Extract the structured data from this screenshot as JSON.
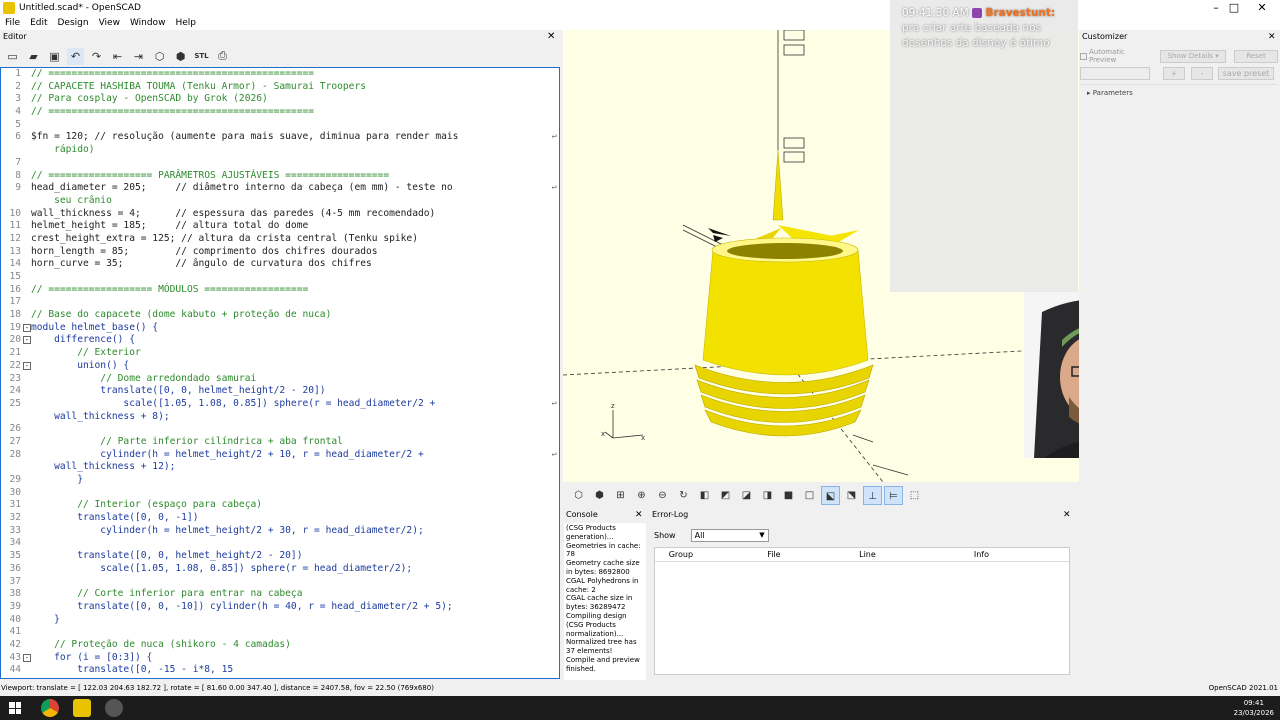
{
  "window": {
    "title": "Untitled.scad* - OpenSCAD",
    "controls": [
      "–",
      "□",
      "✕"
    ]
  },
  "menu": [
    "File",
    "Edit",
    "Design",
    "View",
    "Window",
    "Help"
  ],
  "editor": {
    "title": "Editor",
    "toolbar_icons": [
      "new-icon",
      "open-icon",
      "save-icon",
      "undo-icon",
      "redo-icon",
      "unindent-icon",
      "indent-icon",
      "preview-icon",
      "render-icon",
      "export-stl-icon",
      "send-to-print-icon"
    ],
    "stl_label": "STL",
    "lines": [
      {
        "n": "1",
        "t": "// ==============================================",
        "k": "comment",
        "f": ""
      },
      {
        "n": "2",
        "t": "// CAPACETE HASHIBA TOUMA (Tenku Armor) - Samurai Troopers",
        "k": "comment",
        "f": ""
      },
      {
        "n": "3",
        "t": "// Para cosplay - OpenSCAD by Grok (2026)",
        "k": "comment",
        "f": ""
      },
      {
        "n": "4",
        "t": "// ==============================================",
        "k": "comment",
        "f": ""
      },
      {
        "n": "5",
        "t": "",
        "k": "default",
        "f": ""
      },
      {
        "n": "6",
        "t": "$fn = 120; // resolução (aumente para mais suave, diminua para render mais",
        "k": "default",
        "f": "",
        "w": true
      },
      {
        "n": "",
        "t": "    rápido)",
        "k": "comment",
        "f": ""
      },
      {
        "n": "7",
        "t": "",
        "k": "default",
        "f": ""
      },
      {
        "n": "8",
        "t": "// ================== PARÂMETROS AJUSTÁVEIS ==================",
        "k": "comment",
        "f": ""
      },
      {
        "n": "9",
        "t": "head_diameter = 205;     // diâmetro interno da cabeça (em mm) - teste no",
        "k": "default",
        "f": "",
        "w": true
      },
      {
        "n": "",
        "t": "    seu crânio",
        "k": "comment",
        "f": ""
      },
      {
        "n": "10",
        "t": "wall_thickness = 4;      // espessura das paredes (4-5 mm recomendado)",
        "k": "default",
        "f": ""
      },
      {
        "n": "11",
        "t": "helmet_height = 185;     // altura total do dome",
        "k": "default",
        "f": ""
      },
      {
        "n": "12",
        "t": "crest_height_extra = 125; // altura da crista central (Tenku spike)",
        "k": "default",
        "f": ""
      },
      {
        "n": "13",
        "t": "horn_length = 85;        // comprimento dos chifres dourados",
        "k": "default",
        "f": ""
      },
      {
        "n": "14",
        "t": "horn_curve = 35;         // ângulo de curvatura dos chifres",
        "k": "default",
        "f": ""
      },
      {
        "n": "15",
        "t": "",
        "k": "default",
        "f": ""
      },
      {
        "n": "16",
        "t": "// ================== MÓDULOS ==================",
        "k": "comment",
        "f": ""
      },
      {
        "n": "17",
        "t": "",
        "k": "default",
        "f": ""
      },
      {
        "n": "18",
        "t": "// Base do capacete (dome kabuto + proteção de nuca)",
        "k": "comment",
        "f": ""
      },
      {
        "n": "19",
        "t": "module helmet_base() {",
        "k": "keyword",
        "f": "-"
      },
      {
        "n": "20",
        "t": "    difference() {",
        "k": "keyword",
        "f": "-"
      },
      {
        "n": "21",
        "t": "        // Exterior",
        "k": "comment",
        "f": ""
      },
      {
        "n": "22",
        "t": "        union() {",
        "k": "keyword",
        "f": "-"
      },
      {
        "n": "23",
        "t": "            // Dome arredondado samurai",
        "k": "comment",
        "f": ""
      },
      {
        "n": "24",
        "t": "            translate([0, 0, helmet_height/2 - 20])",
        "k": "keyword",
        "f": ""
      },
      {
        "n": "25",
        "t": "                scale([1.05, 1.08, 0.85]) sphere(r = head_diameter/2 +",
        "k": "keyword",
        "f": "",
        "w": true
      },
      {
        "n": "",
        "t": "    wall_thickness + 8);",
        "k": "keyword",
        "f": ""
      },
      {
        "n": "26",
        "t": "",
        "k": "default",
        "f": ""
      },
      {
        "n": "27",
        "t": "            // Parte inferior cilíndrica + aba frontal",
        "k": "comment",
        "f": ""
      },
      {
        "n": "28",
        "t": "            cylinder(h = helmet_height/2 + 10, r = head_diameter/2 +",
        "k": "keyword",
        "f": "",
        "w": true
      },
      {
        "n": "",
        "t": "    wall_thickness + 12);",
        "k": "keyword",
        "f": ""
      },
      {
        "n": "29",
        "t": "        }",
        "k": "keyword",
        "f": ""
      },
      {
        "n": "30",
        "t": "",
        "k": "default",
        "f": ""
      },
      {
        "n": "31",
        "t": "        // Interior (espaço para cabeça)",
        "k": "comment",
        "f": ""
      },
      {
        "n": "32",
        "t": "        translate([0, 0, -1])",
        "k": "keyword",
        "f": ""
      },
      {
        "n": "33",
        "t": "            cylinder(h = helmet_height/2 + 30, r = head_diameter/2);",
        "k": "keyword",
        "f": ""
      },
      {
        "n": "34",
        "t": "",
        "k": "default",
        "f": ""
      },
      {
        "n": "35",
        "t": "        translate([0, 0, helmet_height/2 - 20])",
        "k": "keyword",
        "f": ""
      },
      {
        "n": "36",
        "t": "            scale([1.05, 1.08, 0.85]) sphere(r = head_diameter/2);",
        "k": "keyword",
        "f": ""
      },
      {
        "n": "37",
        "t": "",
        "k": "default",
        "f": ""
      },
      {
        "n": "38",
        "t": "        // Corte inferior para entrar na cabeça",
        "k": "comment",
        "f": ""
      },
      {
        "n": "39",
        "t": "        translate([0, 0, -10]) cylinder(h = 40, r = head_diameter/2 + 5);",
        "k": "keyword",
        "f": ""
      },
      {
        "n": "40",
        "t": "    }",
        "k": "keyword",
        "f": ""
      },
      {
        "n": "41",
        "t": "",
        "k": "default",
        "f": ""
      },
      {
        "n": "42",
        "t": "    // Proteção de nuca (shikoro - 4 camadas)",
        "k": "comment",
        "f": ""
      },
      {
        "n": "43",
        "t": "    for (i = [0:3]) {",
        "k": "keyword",
        "f": "-"
      },
      {
        "n": "44",
        "t": "        translate([0, -15 - i*8, 15",
        "k": "keyword",
        "f": ""
      }
    ]
  },
  "viewport_toolbar": [
    "preview-icon",
    "render-icon",
    "view-all-icon",
    "zoom-in-icon",
    "zoom-out-icon",
    "reset-view-icon",
    "right-icon",
    "top-icon",
    "bottom-icon",
    "left-icon",
    "front-icon",
    "back-icon",
    "diagonal-icon",
    "perspective-icon",
    "orthogonal-icon",
    "axes-icon",
    "scale-markers-icon",
    "edges-icon"
  ],
  "console": {
    "title": "Console",
    "lines": [
      "(CSG Products generation)...",
      "Geometries in cache: 78",
      "Geometry cache size in bytes: 8692800",
      "CGAL Polyhedrons in cache: 2",
      "CGAL cache size in bytes: 36289472",
      "Compiling design (CSG Products normalization)...",
      "Normalized tree has 37 elements!",
      "Compile and preview finished."
    ]
  },
  "errorlog": {
    "title": "Error-Log",
    "show_label": "Show",
    "show_value": "All",
    "columns": [
      "Group",
      "File",
      "Line",
      "Info"
    ]
  },
  "customizer": {
    "title": "Customizer",
    "auto_preview": "Automatic Preview",
    "show_details": "Show Details",
    "reset": "Reset",
    "plus": "+",
    "minus": "-",
    "save_preset": "save preset",
    "parameters": "Parameters"
  },
  "chat": {
    "time": "09:41:30 AM",
    "user": "Bravestunt:",
    "message": "pra criar arte baseada nos desenhos da disney é ótimo"
  },
  "status": {
    "viewport": "Viewport: translate = [ 122.03 204.63 182.72 ], rotate = [ 81.60 0.00 347.40 ], distance = 2407.58, fov = 22.50 (769x680)",
    "version": "OpenSCAD 2021.01"
  },
  "taskbar": {
    "time": "09:41",
    "date": "23/03/2026"
  },
  "colors": {
    "model": "#f5e400",
    "viewport_bg": "#ffffe5",
    "accent": "#1e6fd0"
  }
}
